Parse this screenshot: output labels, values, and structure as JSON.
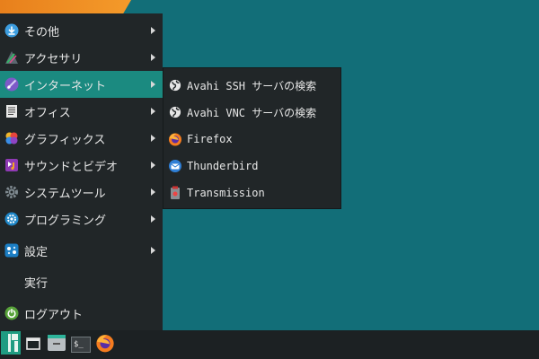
{
  "main_menu": {
    "items": [
      {
        "label": "その他",
        "icon": "download-icon",
        "has_submenu": true
      },
      {
        "label": "アクセサリ",
        "icon": "accessories-icon",
        "has_submenu": true
      },
      {
        "label": "インターネット",
        "icon": "internet-icon",
        "has_submenu": true,
        "active": true
      },
      {
        "label": "オフィス",
        "icon": "document-icon",
        "has_submenu": true
      },
      {
        "label": "グラフィックス",
        "icon": "graphics-icon",
        "has_submenu": true
      },
      {
        "label": "サウンドとビデオ",
        "icon": "multimedia-icon",
        "has_submenu": true
      },
      {
        "label": "システムツール",
        "icon": "system-gear-icon",
        "has_submenu": true
      },
      {
        "label": "プログラミング",
        "icon": "programming-gear-icon",
        "has_submenu": true
      },
      {
        "label": "設定",
        "icon": "settings-icon",
        "has_submenu": true
      },
      {
        "label": "実行",
        "icon": "",
        "has_submenu": false
      },
      {
        "label": "ログアウト",
        "icon": "logout-icon",
        "has_submenu": false
      }
    ]
  },
  "internet_submenu": {
    "items": [
      {
        "label": "Avahi SSH サーバの検索",
        "icon": "globe-icon"
      },
      {
        "label": "Avahi VNC サーバの検索",
        "icon": "globe-icon"
      },
      {
        "label": "Firefox",
        "icon": "firefox-icon"
      },
      {
        "label": "Thunderbird",
        "icon": "thunderbird-icon"
      },
      {
        "label": "Transmission",
        "icon": "transmission-icon"
      }
    ]
  },
  "taskbar": {
    "items": [
      {
        "icon": "manjaro-menu-icon"
      },
      {
        "icon": "show-desktop-icon"
      },
      {
        "icon": "file-manager-icon"
      },
      {
        "icon": "terminal-icon",
        "text": "$_"
      },
      {
        "icon": "firefox-icon"
      }
    ]
  },
  "colors": {
    "desktop": "#126e78",
    "menu_bg": "#212628",
    "highlight": "#1b8a80",
    "taskbar": "#1c2123"
  }
}
